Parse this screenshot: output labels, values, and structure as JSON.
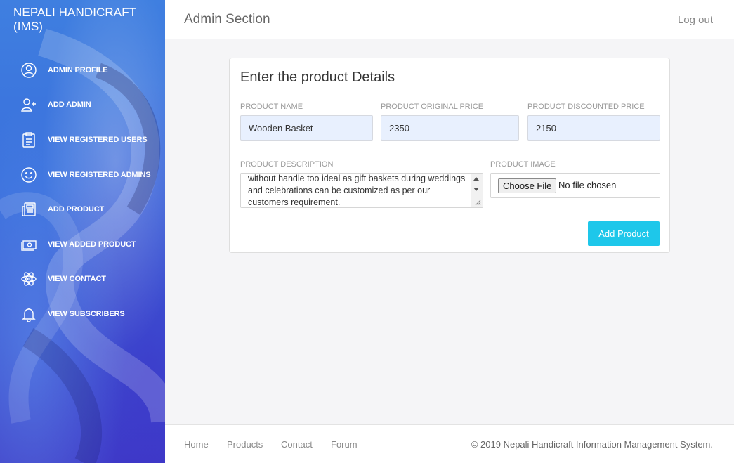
{
  "sidebar": {
    "brand": "NEPALI HANDICRAFT (IMS)",
    "items": [
      {
        "label": "ADMIN PROFILE",
        "icon": "user-circle-icon"
      },
      {
        "label": "ADD ADMIN",
        "icon": "add-user-icon"
      },
      {
        "label": "VIEW REGISTERED USERS",
        "icon": "clipboard-icon"
      },
      {
        "label": "VIEW REGISTERED ADMINS",
        "icon": "smiley-icon"
      },
      {
        "label": "ADD PRODUCT",
        "icon": "newspaper-icon"
      },
      {
        "label": "VIEW ADDED PRODUCT",
        "icon": "money-icon"
      },
      {
        "label": "VIEW CONTACT",
        "icon": "atom-icon"
      },
      {
        "label": "VIEW SUBSCRIBERS",
        "icon": "bell-icon"
      }
    ]
  },
  "header": {
    "title": "Admin Section",
    "logout_label": "Log out"
  },
  "form": {
    "title": "Enter the product Details",
    "product_name_label": "PRODUCT NAME",
    "product_name_value": "Wooden Basket",
    "original_price_label": "PRODUCT ORIGINAL PRICE",
    "original_price_value": "2350",
    "discounted_price_label": "PRODUCT DISCOUNTED PRICE",
    "discounted_price_value": "2150",
    "description_label": "PRODUCT DESCRIPTION",
    "description_value": "without handle too ideal as gift baskets during weddings and celebrations can be customized as per our customers requirement.",
    "image_label": "PRODUCT IMAGE",
    "choose_file_label": "Choose File",
    "no_file_text": "No file chosen",
    "submit_label": "Add Product"
  },
  "footer": {
    "links": [
      "Home",
      "Products",
      "Contact",
      "Forum"
    ],
    "copyright": "© 2019 Nepali Handicraft Information Management System."
  },
  "colors": {
    "accent": "#1ec7ea",
    "sidebar_top": "#3f7fe0",
    "sidebar_bottom": "#3f3fc8"
  }
}
